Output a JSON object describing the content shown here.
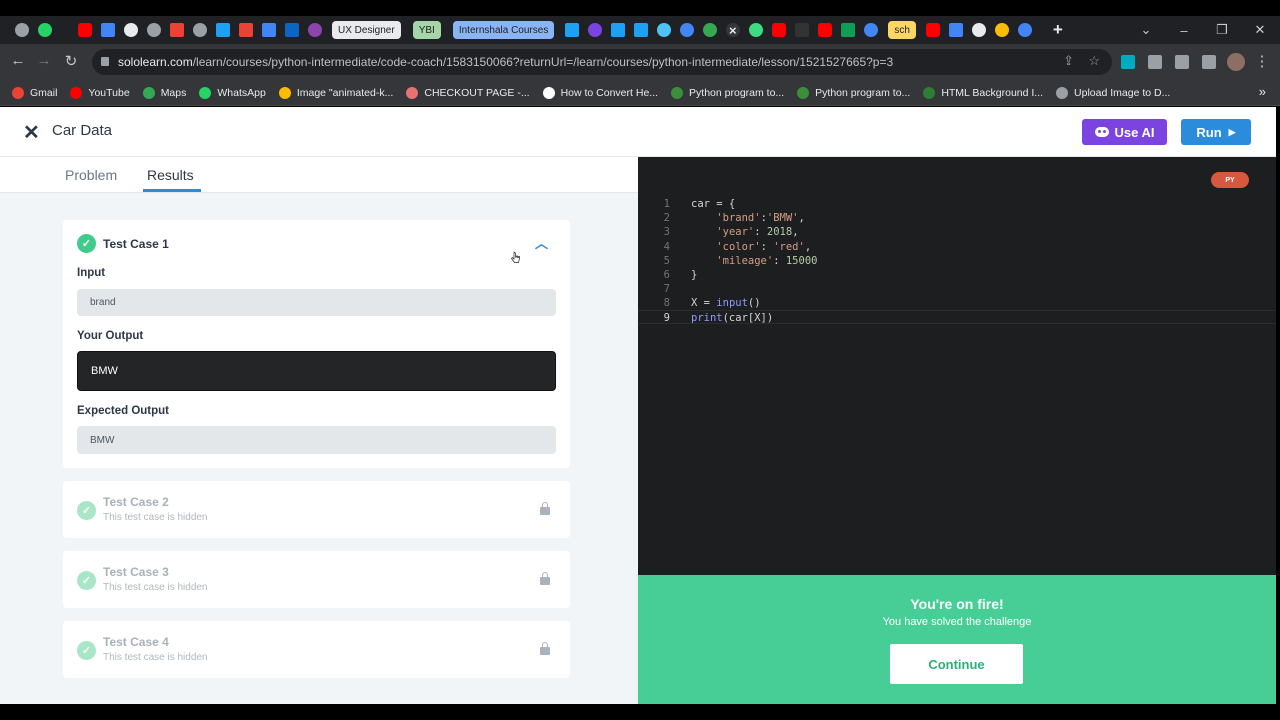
{
  "browser": {
    "tab_pills": [
      {
        "label": "UX Designer",
        "bg": "#e8eaed"
      },
      {
        "label": "YBI",
        "bg": "#a5d6a7"
      },
      {
        "label": "Internshala Courses",
        "bg": "#8ab4f8"
      },
      {
        "label": "sch",
        "bg": "#fdd663"
      }
    ],
    "url_host": "sololearn.com",
    "url_path": "/learn/courses/python-intermediate/code-coach/1583150066?returnUrl=/learn/courses/python-intermediate/lesson/1521527665?p=3",
    "bookmarks": [
      {
        "label": "Gmail",
        "color": "#ea4335"
      },
      {
        "label": "YouTube",
        "color": "#ff0000"
      },
      {
        "label": "Maps",
        "color": "#34a853"
      },
      {
        "label": "WhatsApp",
        "color": "#25d366"
      },
      {
        "label": "Image \"animated-k...",
        "color": "#fbbc04"
      },
      {
        "label": "CHECKOUT PAGE -...",
        "color": "#e57373"
      },
      {
        "label": "How to Convert He...",
        "color": "#ffffff"
      },
      {
        "label": "Python program to...",
        "color": "#3a8f3a"
      },
      {
        "label": "Python program to...",
        "color": "#3a8f3a"
      },
      {
        "label": "HTML Background I...",
        "color": "#2e7d32"
      },
      {
        "label": "Upload Image to D...",
        "color": "#9aa0a6"
      }
    ]
  },
  "header": {
    "title": "Car Data",
    "use_ai_label": "Use AI",
    "run_label": "Run"
  },
  "tabs": {
    "problem": "Problem",
    "results": "Results"
  },
  "test_case_1": {
    "title": "Test Case 1",
    "input_label": "Input",
    "input_value": "brand",
    "your_output_label": "Your Output",
    "your_output_value": "BMW",
    "expected_label": "Expected Output",
    "expected_value": "BMW"
  },
  "hidden_cases": [
    {
      "title": "Test Case 2",
      "subtitle": "This test case is hidden"
    },
    {
      "title": "Test Case 3",
      "subtitle": "This test case is hidden"
    },
    {
      "title": "Test Case 4",
      "subtitle": "This test case is hidden"
    }
  ],
  "editor": {
    "language_badge": "PY",
    "line_numbers": [
      "1",
      "2",
      "3",
      "4",
      "5",
      "6",
      "7",
      "8",
      "9"
    ]
  },
  "success": {
    "title": "You're on fire!",
    "subtitle": "You have solved the challenge",
    "continue_label": "Continue"
  },
  "colors": {
    "accent_green": "#47cd96",
    "run_blue": "#2b8cdb",
    "ai_purple": "#7b44e0"
  }
}
